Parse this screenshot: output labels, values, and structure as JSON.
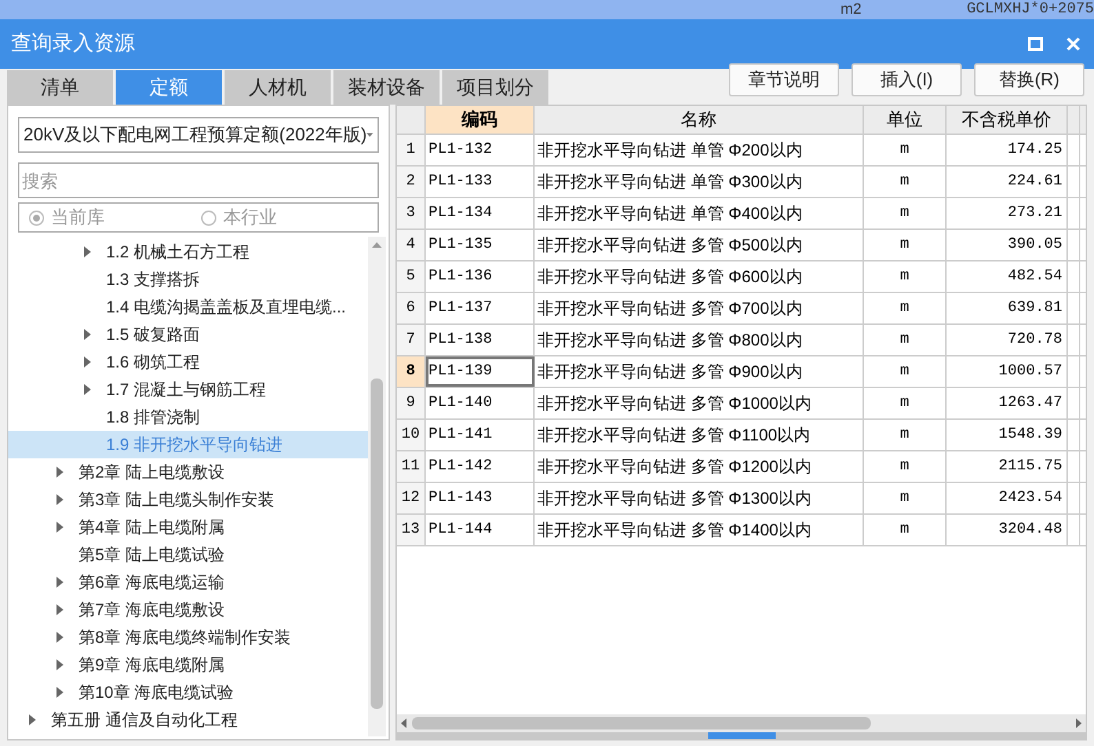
{
  "background_row": {
    "unit": "m2",
    "formula": "GCLMXHJ*0+2075"
  },
  "window": {
    "title": "查询录入资源"
  },
  "tabs": [
    {
      "label": "清单",
      "selected": false
    },
    {
      "label": "定额",
      "selected": true
    },
    {
      "label": "人材机",
      "selected": false
    },
    {
      "label": "装材设备",
      "selected": false
    },
    {
      "label": "项目划分",
      "selected": false
    }
  ],
  "buttons": [
    "章节说明",
    "插入(I)",
    "替换(R)"
  ],
  "library_select": {
    "value": "20kV及以下配电网工程预算定额(2022年版)"
  },
  "search": {
    "placeholder": "搜索"
  },
  "scope": [
    {
      "label": "当前库",
      "selected": true
    },
    {
      "label": "本行业",
      "selected": false
    }
  ],
  "tree": [
    {
      "children": [
        {
          "children": [
            {
              "label": "1.2 机械土石方工程",
              "expandable": true,
              "selected": false
            },
            {
              "label": "1.3 支撑搭拆",
              "expandable": false,
              "selected": false
            },
            {
              "label": "1.4 电缆沟揭盖盖板及直埋电缆...",
              "expandable": false,
              "selected": false
            },
            {
              "label": "1.5 破复路面",
              "expandable": true,
              "selected": false
            },
            {
              "label": "1.6 砌筑工程",
              "expandable": true,
              "selected": false
            },
            {
              "label": "1.7 混凝土与钢筋工程",
              "expandable": true,
              "selected": false
            },
            {
              "label": "1.8 排管浇制",
              "expandable": false,
              "selected": false
            },
            {
              "label": "1.9 非开挖水平导向钻进",
              "expandable": false,
              "selected": true
            }
          ]
        },
        {
          "label": "第2章 陆上电缆敷设",
          "expandable": true,
          "selected": false
        },
        {
          "label": "第3章 陆上电缆头制作安装",
          "expandable": true,
          "selected": false
        },
        {
          "label": "第4章 陆上电缆附属",
          "expandable": true,
          "selected": false
        },
        {
          "label": "第5章 陆上电缆试验",
          "expandable": false,
          "selected": false
        },
        {
          "label": "第6章 海底电缆运输",
          "expandable": true,
          "selected": false
        },
        {
          "label": "第7章 海底电缆敷设",
          "expandable": true,
          "selected": false
        },
        {
          "label": "第8章 海底电缆终端制作安装",
          "expandable": true,
          "selected": false
        },
        {
          "label": "第9章 海底电缆附属",
          "expandable": true,
          "selected": false
        },
        {
          "label": "第10章 海底电缆试验",
          "expandable": true,
          "selected": false
        }
      ]
    },
    {
      "label": "第五册 通信及自动化工程",
      "expandable": true,
      "selected": false
    }
  ],
  "table": {
    "columns": [
      {
        "label": "编码",
        "selected": true
      },
      {
        "label": "名称",
        "selected": false
      },
      {
        "label": "单位",
        "selected": false
      },
      {
        "label": "不含税单价",
        "selected": false
      }
    ],
    "rows": [
      {
        "index": "1",
        "code": "PL1-132",
        "name": "非开挖水平导向钻进 单管 Φ200以内",
        "unit": "m",
        "price": "174.25",
        "selected": false
      },
      {
        "index": "2",
        "code": "PL1-133",
        "name": "非开挖水平导向钻进 单管 Φ300以内",
        "unit": "m",
        "price": "224.61",
        "selected": false
      },
      {
        "index": "3",
        "code": "PL1-134",
        "name": "非开挖水平导向钻进 单管 Φ400以内",
        "unit": "m",
        "price": "273.21",
        "selected": false
      },
      {
        "index": "4",
        "code": "PL1-135",
        "name": "非开挖水平导向钻进 多管 Φ500以内",
        "unit": "m",
        "price": "390.05",
        "selected": false
      },
      {
        "index": "5",
        "code": "PL1-136",
        "name": "非开挖水平导向钻进 多管 Φ600以内",
        "unit": "m",
        "price": "482.54",
        "selected": false
      },
      {
        "index": "6",
        "code": "PL1-137",
        "name": "非开挖水平导向钻进 多管 Φ700以内",
        "unit": "m",
        "price": "639.81",
        "selected": false
      },
      {
        "index": "7",
        "code": "PL1-138",
        "name": "非开挖水平导向钻进 多管 Φ800以内",
        "unit": "m",
        "price": "720.78",
        "selected": false
      },
      {
        "index": "8",
        "code": "PL1-139",
        "name": "非开挖水平导向钻进 多管 Φ900以内",
        "unit": "m",
        "price": "1000.57",
        "selected": true
      },
      {
        "index": "9",
        "code": "PL1-140",
        "name": "非开挖水平导向钻进 多管 Φ1000以内",
        "unit": "m",
        "price": "1263.47",
        "selected": false
      },
      {
        "index": "10",
        "code": "PL1-141",
        "name": "非开挖水平导向钻进 多管 Φ1100以内",
        "unit": "m",
        "price": "1548.39",
        "selected": false
      },
      {
        "index": "11",
        "code": "PL1-142",
        "name": "非开挖水平导向钻进 多管 Φ1200以内",
        "unit": "m",
        "price": "2115.75",
        "selected": false
      },
      {
        "index": "12",
        "code": "PL1-143",
        "name": "非开挖水平导向钻进 多管 Φ1300以内",
        "unit": "m",
        "price": "2423.54",
        "selected": false
      },
      {
        "index": "13",
        "code": "PL1-144",
        "name": "非开挖水平导向钻进 多管 Φ1400以内",
        "unit": "m",
        "price": "3204.48",
        "selected": false
      }
    ]
  }
}
